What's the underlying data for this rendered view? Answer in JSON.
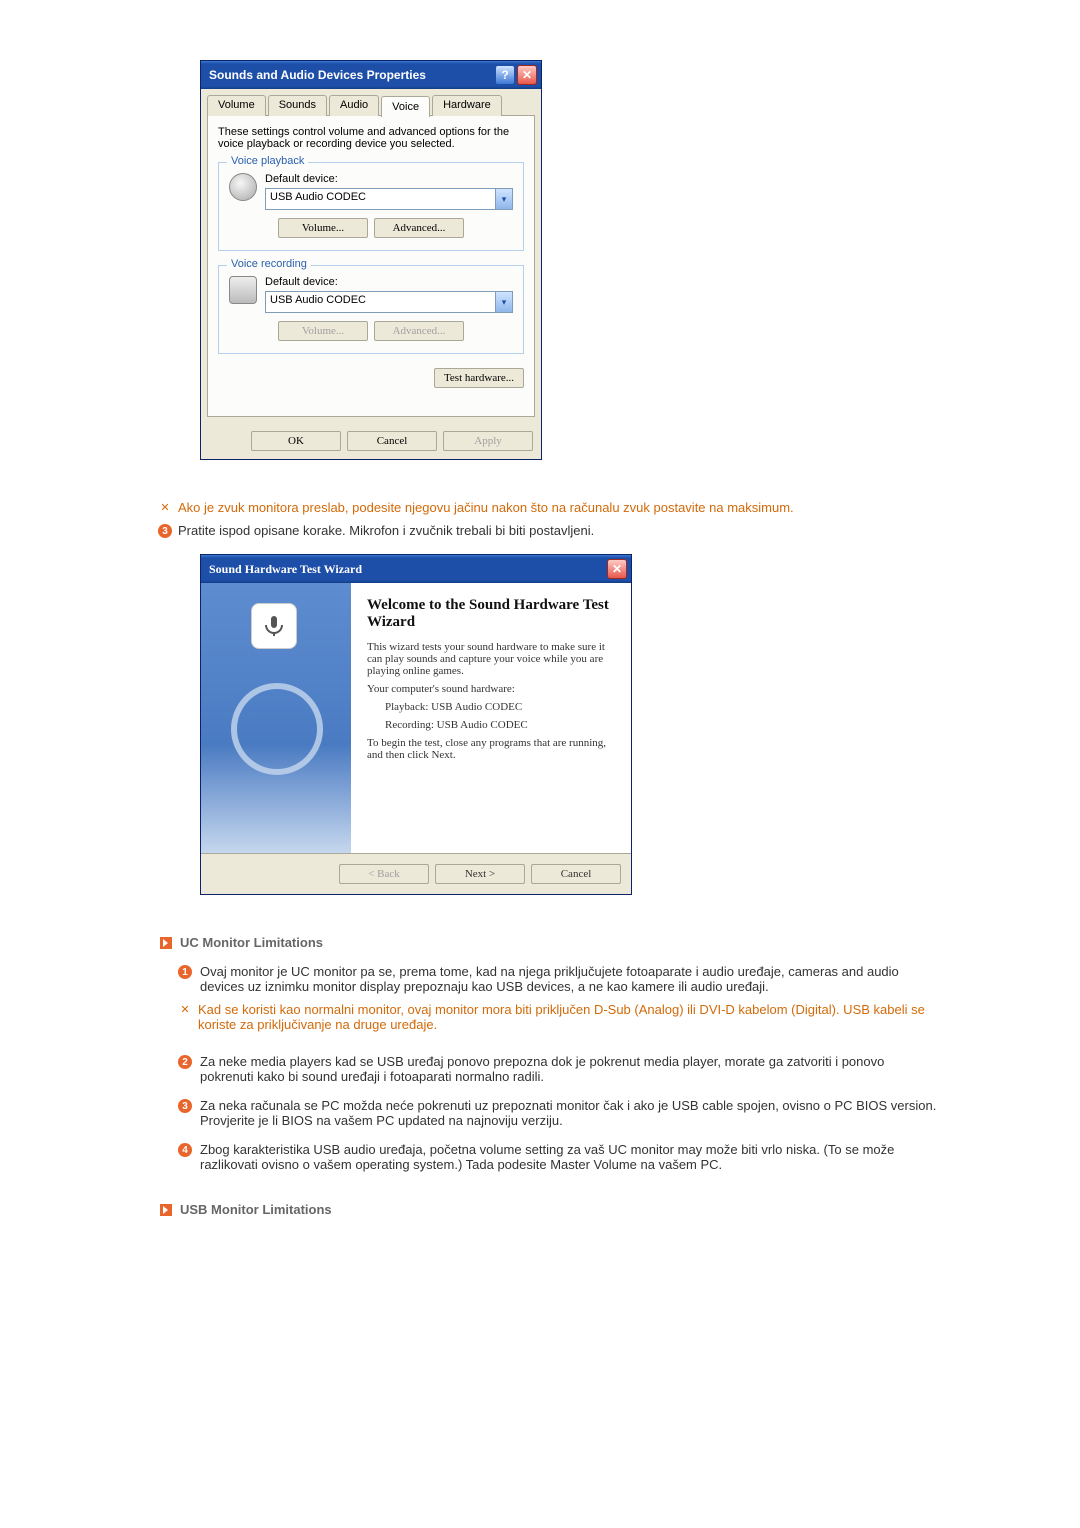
{
  "dialog1": {
    "title": "Sounds and Audio Devices Properties",
    "help": "?",
    "close": "✕",
    "tabs": {
      "volume": "Volume",
      "sounds": "Sounds",
      "audio": "Audio",
      "voice": "Voice",
      "hardware": "Hardware"
    },
    "desc": "These settings control volume and advanced options for the voice playback or recording device you selected.",
    "playback": {
      "legend": "Voice playback",
      "label": "Default device:",
      "value": "USB Audio CODEC",
      "vol_btn": "Volume...",
      "adv_btn": "Advanced..."
    },
    "recording": {
      "legend": "Voice recording",
      "label": "Default device:",
      "value": "USB Audio CODEC",
      "vol_btn": "Volume...",
      "adv_btn": "Advanced..."
    },
    "test_btn": "Test hardware...",
    "ok": "OK",
    "cancel": "Cancel",
    "apply": "Apply"
  },
  "note1": "Ako je zvuk monitora preslab, podesite njegovu jačinu nakon što na računalu zvuk postavite na maksimum.",
  "step3_badge": "3",
  "step3": "Pratite ispod opisane korake. Mikrofon i zvučnik trebali bi biti postavljeni.",
  "wizard": {
    "title": "Sound Hardware Test Wizard",
    "close": "✕",
    "heading": "Welcome to the Sound Hardware Test Wizard",
    "p1": "This wizard tests your sound hardware to make sure it can play sounds and capture your voice while you are playing online games.",
    "p2": "Your computer's sound hardware:",
    "pb": "Playback:  USB Audio CODEC",
    "rec": "Recording:  USB Audio CODEC",
    "p3": "To begin the test, close any programs that are running, and then click Next.",
    "back": "< Back",
    "next": "Next >",
    "cancel": "Cancel"
  },
  "sec1": {
    "title": "UC Monitor Limitations",
    "items": {
      "n1": "1",
      "t1": "Ovaj monitor je UC monitor pa se, prema tome, kad na njega priključujete fotoaparate i audio uređaje, cameras and audio devices uz iznimku monitor display prepoznaju kao USB devices, a ne kao kamere ili audio uređaji.",
      "t1o": "Kad se koristi kao normalni monitor, ovaj monitor mora biti priključen D-Sub (Analog) ili DVI-D kabelom (Digital). USB kabeli se koriste za priključivanje na druge uređaje.",
      "n2": "2",
      "t2": "Za neke media players kad se USB uređaj ponovo prepozna dok je pokrenut media player, morate ga zatvoriti i ponovo pokrenuti kako bi sound uređaji i fotoaparati normalno radili.",
      "n3": "3",
      "t3": "Za neka računala se PC možda neće pokrenuti uz prepoznati monitor čak i ako je USB cable spojen, ovisno o PC BIOS version.\nProvjerite je li BIOS na vašem PC updated na najnoviju verziju.",
      "n4": "4",
      "t4": "Zbog karakteristika USB audio uređaja, početna volume setting za vaš UC monitor may može biti vrlo niska. (To se može razlikovati ovisno o vašem operating system.) Tada podesite Master Volume na vašem PC."
    }
  },
  "sec2": {
    "title": "USB Monitor Limitations"
  }
}
